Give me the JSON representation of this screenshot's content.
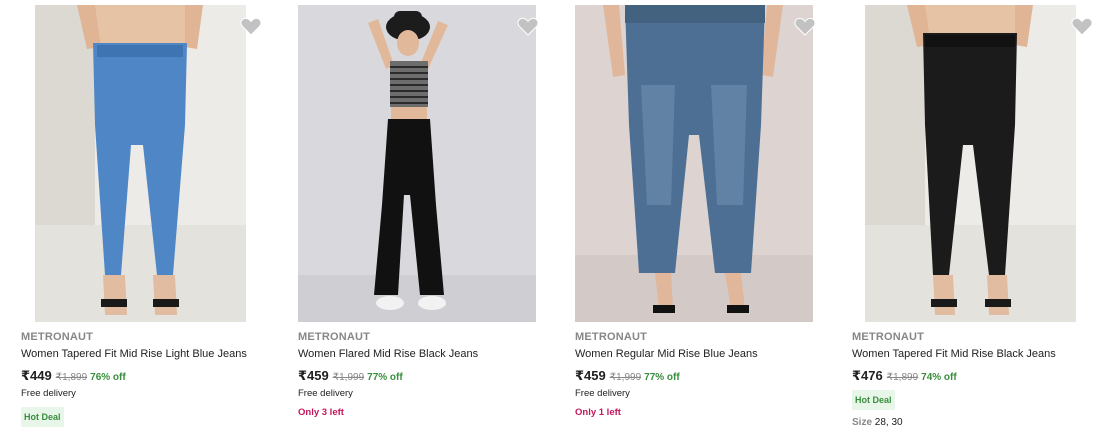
{
  "colors": {
    "offer_green": "#388e3c",
    "hot_deal_bg": "#e8f5e9",
    "stock_pink": "#c2185b",
    "muted_gray": "#878787"
  },
  "products": [
    {
      "brand": "METRONAUT",
      "title": "Women Tapered Fit Mid Rise Light Blue Jeans",
      "price": "₹449",
      "mrp": "₹1,899",
      "discount": "76% off",
      "delivery": "Free delivery",
      "badge": "Hot Deal",
      "wishlist_icon": "heart-icon"
    },
    {
      "brand": "METRONAUT",
      "title": "Women Flared Mid Rise Black Jeans",
      "price": "₹459",
      "mrp": "₹1,999",
      "discount": "77% off",
      "delivery": "Free delivery",
      "stock": "Only 3 left",
      "wishlist_icon": "heart-icon"
    },
    {
      "brand": "METRONAUT",
      "title": "Women Regular Mid Rise Blue Jeans",
      "price": "₹459",
      "mrp": "₹1,999",
      "discount": "77% off",
      "delivery": "Free delivery",
      "stock": "Only 1 left",
      "wishlist_icon": "heart-icon"
    },
    {
      "brand": "METRONAUT",
      "title": "Women Tapered Fit Mid Rise Black Jeans",
      "price": "₹476",
      "mrp": "₹1,899",
      "discount": "74% off",
      "badge": "Hot Deal",
      "size_label": "Size",
      "sizes": "28, 30",
      "wishlist_icon": "heart-icon"
    }
  ]
}
